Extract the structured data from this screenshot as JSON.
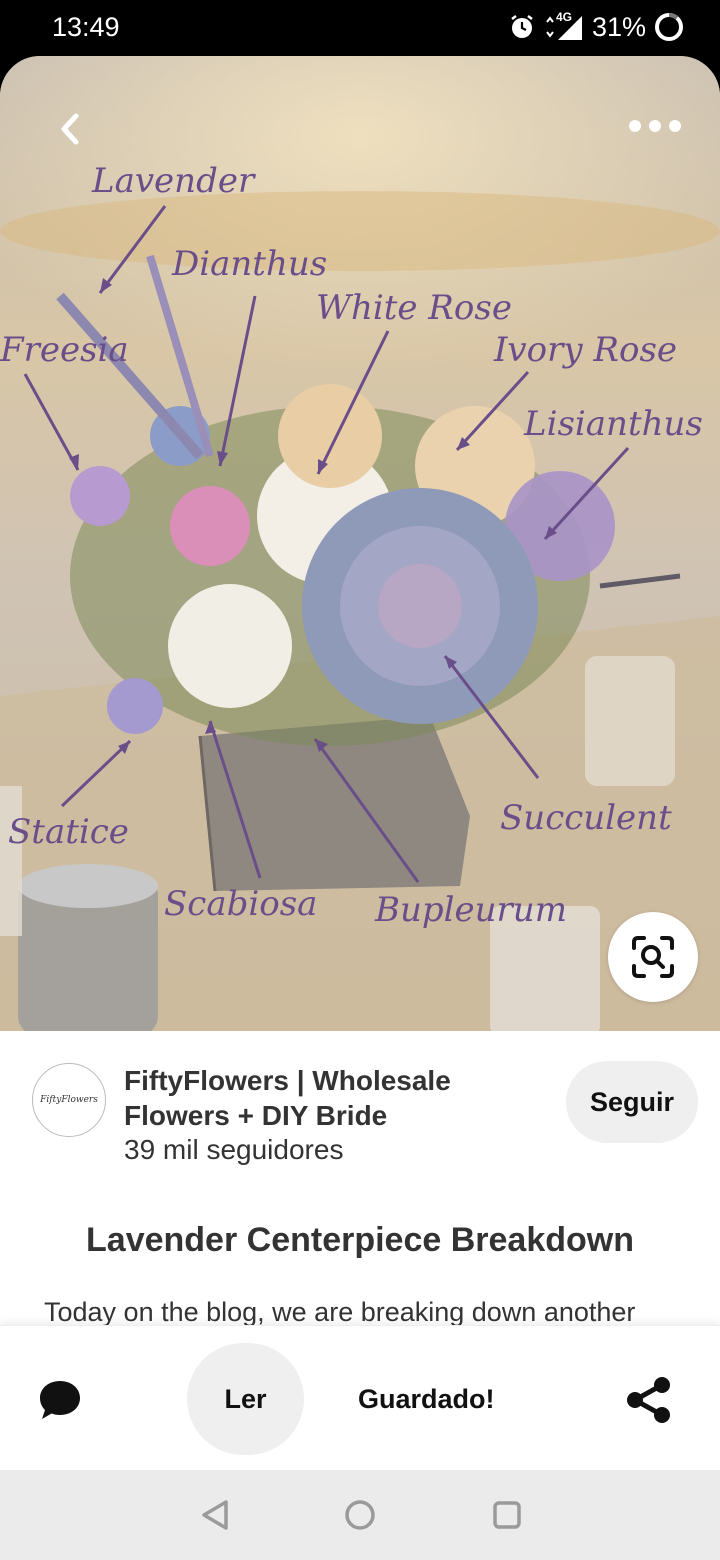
{
  "status": {
    "time": "13:49",
    "network": "4G",
    "battery": "31%",
    "icons": [
      "alarm-icon",
      "signal-icon",
      "battery-icon"
    ]
  },
  "pin_image": {
    "labels": {
      "lavender": "Lavender",
      "dianthus": "Dianthus",
      "white_rose": "White Rose",
      "freesia": "Freesia",
      "ivory_rose": "Ivory Rose",
      "lisianthus": "Lisianthus",
      "statice": "Statice",
      "succulent": "Succulent",
      "scabiosa": "Scabiosa",
      "bupleurum": "Bupleurum"
    },
    "icons": [
      "back-icon",
      "more-icon",
      "visual-search-icon"
    ]
  },
  "creator": {
    "name": "FiftyFlowers | Wholesale Flowers + DIY Bride",
    "followers": "39 mil seguidores",
    "avatar_text": "FiftyFlowers",
    "follow_label": "Seguir"
  },
  "pin": {
    "title": "Lavender Centerpiece Breakdown",
    "description": "Today on the blog, we are breaking down another"
  },
  "actions": {
    "read_label": "Ler",
    "saved_label": "Guardado!",
    "icons": [
      "comment-icon",
      "share-icon"
    ]
  },
  "nav": {
    "icons": [
      "nav-back-icon",
      "nav-home-icon",
      "nav-recents-icon"
    ]
  },
  "colors": {
    "label_purple": "#6a4e8a",
    "button_gray": "#efefef",
    "text_dark": "#333333"
  }
}
